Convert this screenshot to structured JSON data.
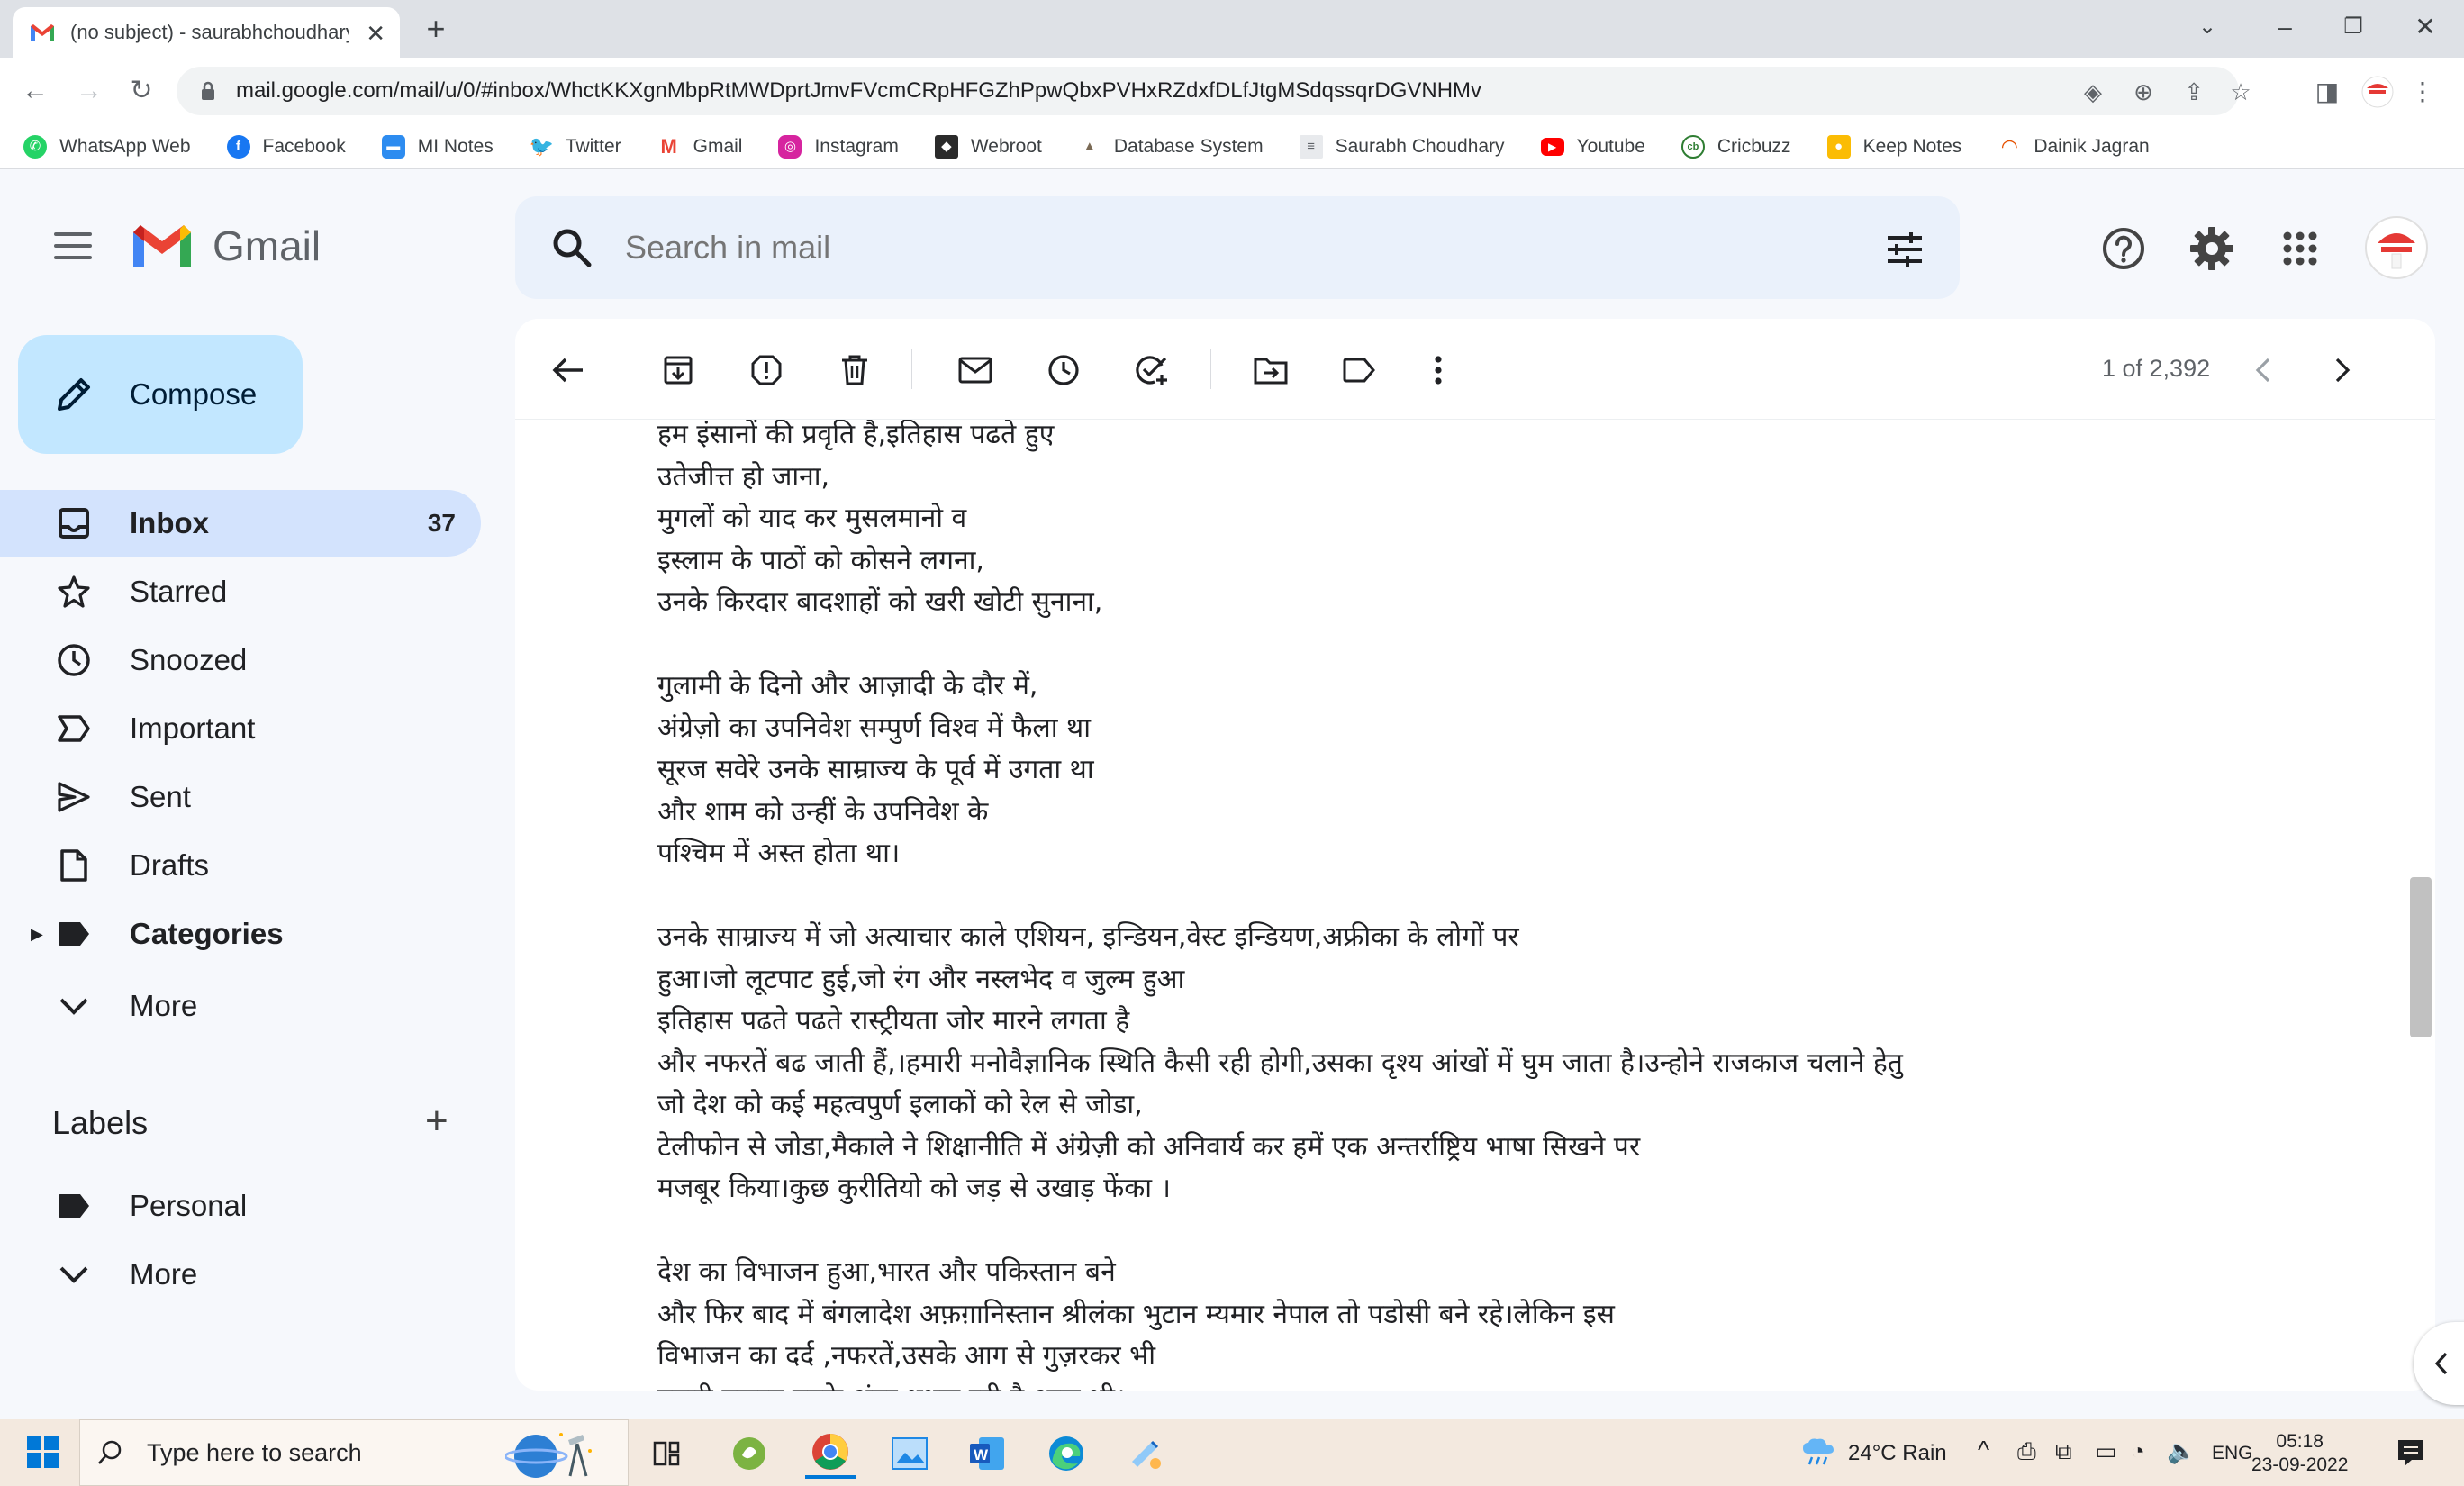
{
  "browser": {
    "tab_title": "(no subject) - saurabhchoudhary",
    "url": "mail.google.com/mail/u/0/#inbox/WhctKKXgnMbpRtMWDprtJmvFVcmCRpHFGZhPpwQbxPVHxRZdxfDLfJtgMSdqssqrDGVNHMv",
    "bookmarks": [
      {
        "label": "WhatsApp Web",
        "icon": "whatsapp-icon",
        "color": "#25d366"
      },
      {
        "label": "Facebook",
        "icon": "facebook-icon",
        "color": "#1877f2"
      },
      {
        "label": "MI Notes",
        "icon": "notes-icon",
        "color": "#2d8cf0"
      },
      {
        "label": "Twitter",
        "icon": "twitter-icon",
        "color": "#1da1f2"
      },
      {
        "label": "Gmail",
        "icon": "gmail-icon",
        "color": "#ea4335"
      },
      {
        "label": "Instagram",
        "icon": "instagram-icon",
        "color": "#d6249f"
      },
      {
        "label": "Webroot",
        "icon": "webroot-icon",
        "color": "#2b2b2b"
      },
      {
        "label": "Database System",
        "icon": "database-icon",
        "color": "#7a6a55"
      },
      {
        "label": "Saurabh Choudhary",
        "icon": "page-icon",
        "color": "#9aa0a6"
      },
      {
        "label": "Youtube",
        "icon": "youtube-icon",
        "color": "#ff0000"
      },
      {
        "label": "Cricbuzz",
        "icon": "cricbuzz-icon",
        "color": "#2e7d32"
      },
      {
        "label": "Keep Notes",
        "icon": "keep-icon",
        "color": "#fbbc04"
      },
      {
        "label": "Dainik Jagran",
        "icon": "jagran-icon",
        "color": "#e65100"
      }
    ]
  },
  "gmail": {
    "logo_text": "Gmail",
    "search_placeholder": "Search in mail",
    "compose_label": "Compose",
    "nav": [
      {
        "label": "Inbox",
        "count": "37"
      },
      {
        "label": "Starred"
      },
      {
        "label": "Snoozed"
      },
      {
        "label": "Important"
      },
      {
        "label": "Sent"
      },
      {
        "label": "Drafts"
      },
      {
        "label": "Categories"
      },
      {
        "label": "More"
      }
    ],
    "labels_title": "Labels",
    "labels": [
      {
        "label": "Personal"
      },
      {
        "label": "More"
      }
    ],
    "pager": "1 of 2,392"
  },
  "email_body": [
    "हम इंसानों की प्रवृति है,इतिहास पढते हुए",
    "उतेजीत्त हो जाना,",
    "मुगलों को याद कर मुसलमानो व",
    "इस्लाम के पाठों को कोसने लगना,",
    "उनके किरदार बादशाहों को खरी खोटी सुनाना,",
    "",
    "गुलामी के दिनो और आज़ादी के दौर में,",
    "  अंग्रेज़ो का उपनिवेश सम्पुर्ण  विश्व में फैला था",
    "सूरज सवेरे उनके साम्राज्य के पूर्व में उगता था",
    "और शाम को उन्हीं के उपनिवेश के",
    "पश्चिम में अस्त होता था।",
    "",
    "उनके साम्राज्य में जो अत्याचार  काले एशियन, इन्डियन,वेस्ट इन्डियण,अफ्रीका के लोगों पर",
    "हुआ।जो लूटपाट हुई,जो रंग और नस्लभेद व जुल्म हुआ",
    "इतिहास पढते पढते रास्ट्रीयता जोर मारने लगता है",
    "और नफरतें बढ जाती हैं,।हमारी मनोवैज्ञानिक स्थिति कैसी रही होगी,उसका दृश्य आंखों में घुम जाता है।उन्होने राजकाज चलाने हेतु",
    "जो देश को कई महत्वपुर्ण इलाकों को रेल से जोडा,",
    "टेलीफोन से जोडा,मैकाले ने शिक्षानीति में अंग्रेज़ी को अनिवार्य कर हमें एक अन्तर्राष्ट्रिय भाषा सिखने पर",
    "मजबूर किया।कुछ कुरीतियो को जड़ से उखाड़ फेंका ।",
    "",
    "देश का विभाजन हुआ,भारत और पकिस्तान बने",
    "और फिर बाद में बंगलादेश अफ़ग़ानिस्तान श्रीलंका भुटान म्यमार नेपाल तो पडोसी बने रहे।लेकिन इस",
    "विभाजन का दर्द ,नफरतें,उसके आग से गुज़रकर भी",
    "हमारी नफरत उनके अंदर धधक रही है आज भी।"
  ],
  "taskbar": {
    "search_placeholder": "Type here to search",
    "weather": "24°C  Rain",
    "language": "ENG",
    "time": "05:18",
    "date": "23-09-2022"
  }
}
